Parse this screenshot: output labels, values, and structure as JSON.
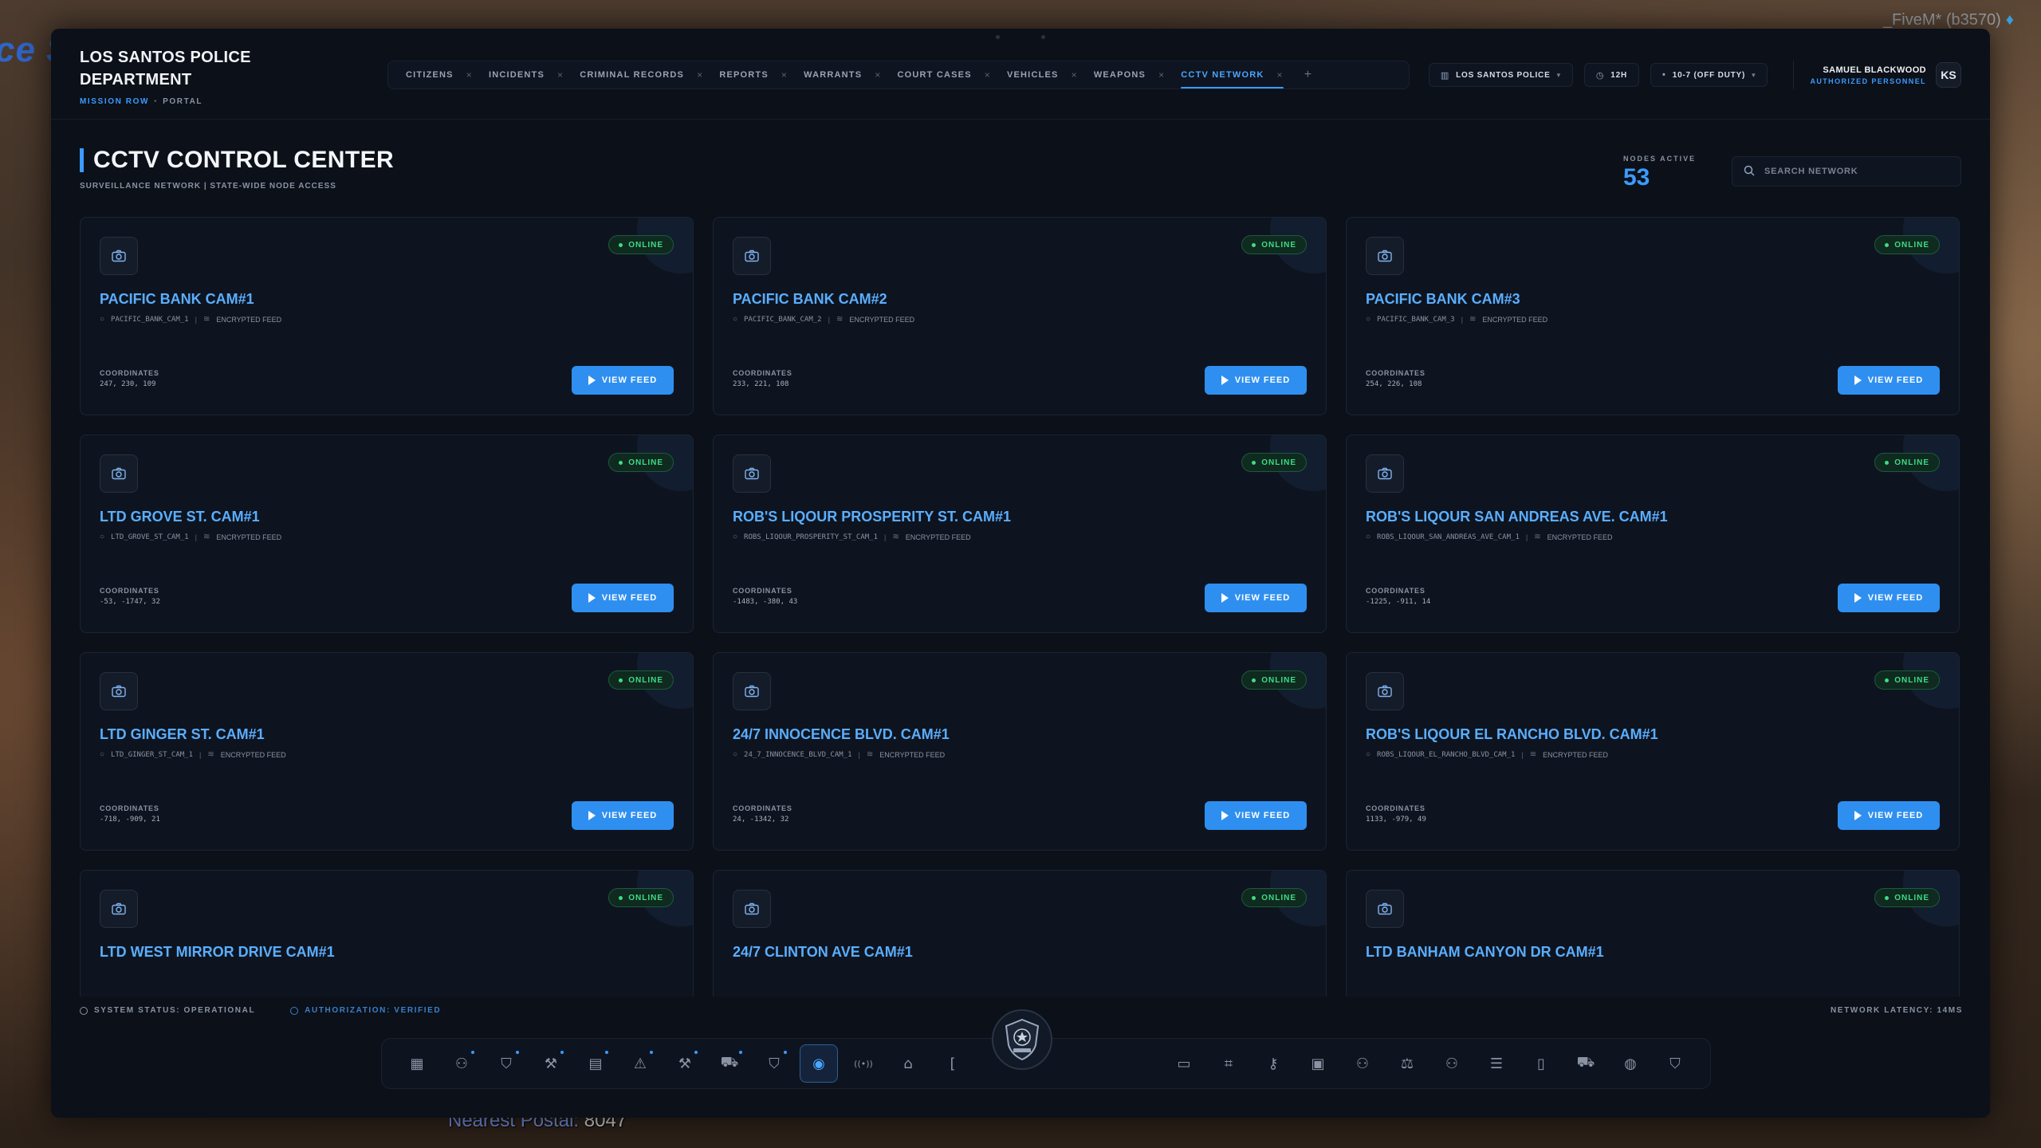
{
  "game": {
    "left_sign": "ce S",
    "client_label": "_FiveM* (b3570)",
    "postal_label": "Nearest Postal:",
    "postal_value": "8047"
  },
  "header": {
    "brand_title": "LOS SANTOS POLICE DEPARTMENT",
    "location": "MISSION ROW",
    "portal": "PORTAL",
    "tabs": [
      {
        "label": "CITIZENS"
      },
      {
        "label": "INCIDENTS"
      },
      {
        "label": "CRIMINAL RECORDS"
      },
      {
        "label": "REPORTS"
      },
      {
        "label": "WARRANTS"
      },
      {
        "label": "COURT CASES"
      },
      {
        "label": "VEHICLES"
      },
      {
        "label": "WEAPONS"
      },
      {
        "label": "CCTV NETWORK",
        "active": true
      }
    ],
    "add_tab": "+",
    "close_glyph": "×",
    "agency": "LOS SANTOS POLICE",
    "time_format": "12H",
    "duty_status": "10-7 (OFF DUTY)",
    "user_name": "SAMUEL BLACKWOOD",
    "user_role": "AUTHORIZED PERSONNEL",
    "avatar_initials": "KS"
  },
  "page": {
    "title": "CCTV CONTROL CENTER",
    "subtitle": "SURVEILLANCE NETWORK | STATE-WIDE NODE ACCESS",
    "nodes_label": "NODES ACTIVE",
    "nodes_count": "53",
    "search_placeholder": "SEARCH NETWORK"
  },
  "card_labels": {
    "status": "ONLINE",
    "feed_type": "ENCRYPTED FEED",
    "coords_label": "COORDINATES",
    "view_button": "VIEW FEED",
    "separator": "|"
  },
  "cameras": [
    {
      "name": "PACIFIC BANK CAM#1",
      "id": "PACIFIC_BANK_CAM_1",
      "coords": "247, 230, 109"
    },
    {
      "name": "PACIFIC BANK CAM#2",
      "id": "PACIFIC_BANK_CAM_2",
      "coords": "233, 221, 108"
    },
    {
      "name": "PACIFIC BANK CAM#3",
      "id": "PACIFIC_BANK_CAM_3",
      "coords": "254, 226, 108"
    },
    {
      "name": "LTD GROVE ST. CAM#1",
      "id": "LTD_GROVE_ST_CAM_1",
      "coords": "-53, -1747, 32"
    },
    {
      "name": "ROB'S LIQOUR PROSPERITY ST. CAM#1",
      "id": "ROBS_LIQOUR_PROSPERITY_ST_CAM_1",
      "coords": "-1483, -380, 43"
    },
    {
      "name": "ROB'S LIQOUR SAN ANDREAS AVE. CAM#1",
      "id": "ROBS_LIQOUR_SAN_ANDREAS_AVE_CAM_1",
      "coords": "-1225, -911, 14"
    },
    {
      "name": "LTD GINGER ST. CAM#1",
      "id": "LTD_GINGER_ST_CAM_1",
      "coords": "-718, -909, 21"
    },
    {
      "name": "24/7 INNOCENCE BLVD. CAM#1",
      "id": "24_7_INNOCENCE_BLVD_CAM_1",
      "coords": "24, -1342, 32"
    },
    {
      "name": "ROB'S LIQOUR EL RANCHO BLVD. CAM#1",
      "id": "ROBS_LIQOUR_EL_RANCHO_BLVD_CAM_1",
      "coords": "1133, -979, 49"
    },
    {
      "name": "LTD WEST MIRROR DRIVE CAM#1",
      "id": "",
      "coords": ""
    },
    {
      "name": "24/7 CLINTON AVE CAM#1",
      "id": "",
      "coords": ""
    },
    {
      "name": "LTD BANHAM CANYON DR CAM#1",
      "id": "",
      "coords": ""
    }
  ],
  "footer": {
    "system_status": "SYSTEM STATUS: OPERATIONAL",
    "authorization": "AUTHORIZATION: VERIFIED",
    "latency": "NETWORK LATENCY: 14MS"
  },
  "dock": {
    "left_items": [
      {
        "icon": "dashboard-icon"
      },
      {
        "icon": "citizens-icon",
        "notify": true
      },
      {
        "icon": "shield-icon",
        "notify": true
      },
      {
        "icon": "gavel-icon",
        "notify": true
      },
      {
        "icon": "document-icon",
        "notify": true
      },
      {
        "icon": "warning-icon",
        "notify": true
      },
      {
        "icon": "hammer-icon",
        "notify": true
      },
      {
        "icon": "car-icon",
        "notify": true
      },
      {
        "icon": "badge-icon",
        "notify": true
      },
      {
        "icon": "camera-icon",
        "active": true
      },
      {
        "icon": "radio-icon"
      },
      {
        "icon": "home-icon"
      },
      {
        "icon": "bracket-icon"
      }
    ],
    "right_items": [
      {
        "icon": "chat-icon"
      },
      {
        "icon": "training-icon"
      },
      {
        "icon": "key-icon"
      },
      {
        "icon": "briefcase-icon"
      },
      {
        "icon": "add-user-icon"
      },
      {
        "icon": "scales-icon"
      },
      {
        "icon": "group-icon"
      },
      {
        "icon": "database-icon"
      },
      {
        "icon": "book-icon"
      },
      {
        "icon": "truck-icon"
      },
      {
        "icon": "palette-icon"
      },
      {
        "icon": "shield-check-icon"
      }
    ]
  },
  "colors": {
    "accent": "#3b9bff",
    "online": "#3ddc84",
    "panel": "#0b1019"
  }
}
